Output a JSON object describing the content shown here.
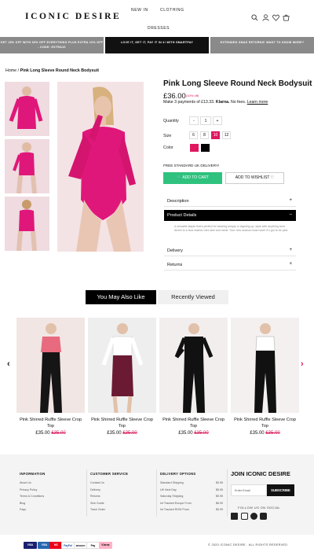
{
  "brand": "ICONIC DESIRE",
  "nav": {
    "new_in": "NEW IN",
    "clothing": "CLOTHING",
    "dresses": "DRESSES"
  },
  "banners": [
    {
      "text": "GET 15% OFF WITH 30% OFF EVERYTHING PLUS EXTRA 10% OFF - CODE: EXTRA10",
      "bg": "#8a8a8a"
    },
    {
      "text": "LOVE IT, GET IT, PAY IT IN 4! WITH SMARTPAY",
      "bg": "#111111"
    },
    {
      "text": "EXTENDED XMAS RETURNS! WANT TO KNOW MORE?",
      "bg": "#8a8a8a"
    }
  ],
  "breadcrumb": {
    "home": "Home",
    "sep": "/",
    "current": "Pink Long Sleeve Round Neck Bodysuit"
  },
  "product": {
    "title": "Pink Long Sleeve Round Neck Bodysuit",
    "price": "£36.00",
    "discount": "(10% off)",
    "klarna_text": "Make 3 payments of £13.33.",
    "klarna_brand": "Klarna.",
    "klarna_fees": "No fees.",
    "learn_more": "Learn more",
    "quantity_label": "Quantity",
    "qty_minus": "-",
    "qty_value": "1",
    "qty_plus": "+",
    "size_label": "Size",
    "sizes": [
      "6",
      "8",
      "10",
      "12"
    ],
    "selected_size": "10",
    "color_label": "Color",
    "colors": [
      "#e0175f",
      "#000000"
    ],
    "free_delivery": "FREE STANDARD UK DELIVERY!",
    "add_to_cart": "ADD TO CART",
    "add_to_wishlist": "ADD TO WISHLIST",
    "accordion": {
      "description": "Description",
      "product_details": "Product Details",
      "details_text": "A versatile staple that's perfect for wearing simply or layering up, style with anything from denim to a faux leather mini skirt and heels. Your new season must have! It's got to be pink.",
      "delivery": "Delivery",
      "returns": "Returns"
    }
  },
  "tabs": {
    "ymal": "You May Also Like",
    "recent": "Recently Viewed"
  },
  "related": [
    {
      "name": "Pink Shirred Ruffle Sleeve Crop Top",
      "price": "£35.00",
      "old": "£35.00"
    },
    {
      "name": "Pink Shirred Ruffle Sleeve Crop Top",
      "price": "£35.00",
      "old": "£35.00"
    },
    {
      "name": "Pink Shirred Ruffle Sleeve Crop Top",
      "price": "£35.00",
      "old": "£35.00"
    },
    {
      "name": "Pink Shirred Ruffle Sleeve Crop Top",
      "price": "£35.00",
      "old": "£35.00"
    }
  ],
  "footer": {
    "info_title": "INFORMATION",
    "info": [
      "About Us",
      "Privacy Policy",
      "Terms & Conditions",
      "Blog",
      "Faqs"
    ],
    "cs_title": "CUSTOMER SERVICE",
    "cs": [
      "Contact Us",
      "Delivery",
      "Returns",
      "Size Guide",
      "Track Order"
    ],
    "do_title": "DELIVERY OPTIONS",
    "delivery": [
      {
        "name": "Standard Shipping",
        "price": "$3.95"
      },
      {
        "name": "UK Next Day",
        "price": "$5.95"
      },
      {
        "name": "Saturday Shipping",
        "price": "$9.95"
      },
      {
        "name": "Int Tracked Europe From",
        "price": "$6.99"
      },
      {
        "name": "Int Tracked ROW From",
        "price": "$9.99"
      }
    ],
    "join_title": "JOIN ICONIC DESIRE",
    "email_placeholder": "Enter Email",
    "subscribe": "SUBSCRIBE",
    "social_title": "FOLLOW US ON SOCIAL",
    "copyright": "© 2020 ICONIC DESIRE . ALL RIGHTS RESERVED"
  },
  "payments": [
    {
      "label": "VISA",
      "bg": "#1a1f71"
    },
    {
      "label": "VISA",
      "bg": "#2566af"
    },
    {
      "label": "MC",
      "bg": "#eb001b"
    },
    {
      "label": "PayPal",
      "bg": "#ffffff"
    },
    {
      "label": "amazon",
      "bg": "#ffffff"
    },
    {
      "label": "Pay",
      "bg": "#ffffff"
    },
    {
      "label": "Klarna",
      "bg": "#ffb3c7"
    }
  ]
}
